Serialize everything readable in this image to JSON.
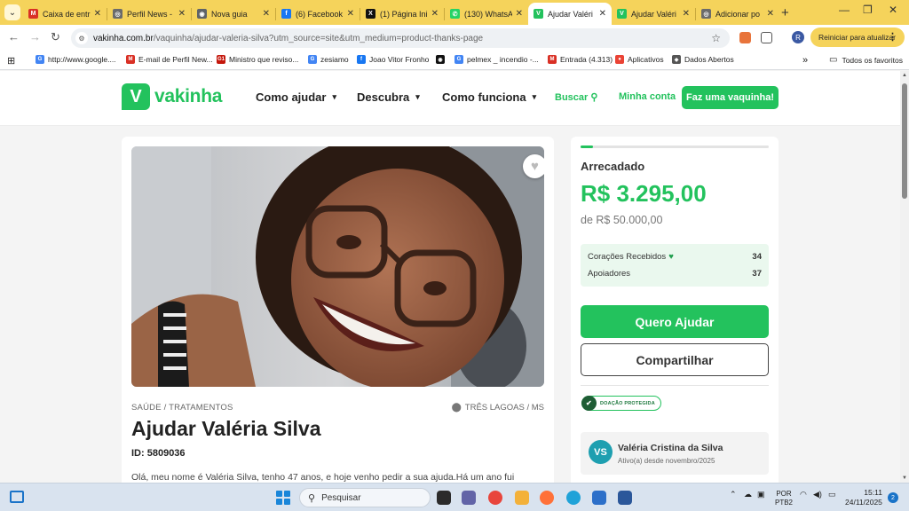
{
  "browser": {
    "tabs": [
      {
        "title": "Caixa de entr",
        "favicon": "gmail-icon",
        "color": "#d93025",
        "glyph": "M",
        "active": false
      },
      {
        "title": "Perfil News -",
        "favicon": "globe-icon",
        "color": "#6b6b6b",
        "glyph": "◎",
        "active": false
      },
      {
        "title": "Nova guia",
        "favicon": "chrome-icon",
        "color": "#5f6368",
        "glyph": "◉",
        "active": false
      },
      {
        "title": "(6) Facebook",
        "favicon": "facebook-icon",
        "color": "#1877f2",
        "glyph": "f",
        "active": false
      },
      {
        "title": "(1) Página Ini",
        "favicon": "x-icon",
        "color": "#111111",
        "glyph": "X",
        "active": false
      },
      {
        "title": "(130) WhatsA",
        "favicon": "whatsapp-icon",
        "color": "#25d366",
        "glyph": "✆",
        "active": false
      },
      {
        "title": "Ajudar Valéri",
        "favicon": "vakinha-icon",
        "color": "#23c25d",
        "glyph": "V",
        "active": true
      },
      {
        "title": "Ajudar Valéri",
        "favicon": "vakinha-icon",
        "color": "#23c25d",
        "glyph": "V",
        "active": false
      },
      {
        "title": "Adicionar po",
        "favicon": "globe-icon",
        "color": "#6b6b6b",
        "glyph": "◎",
        "active": false
      }
    ],
    "url_domain": "vakinha.com.br",
    "url_path": "/vaquinha/ajudar-valeria-silva?utm_source=site&utm_medium=product-thanks-page",
    "profile_initial": "R",
    "update_label": "Reiniciar para atualizar",
    "bookmarks": [
      {
        "label": "http://www.google....",
        "icon": "google-icon",
        "color": "#4285f4",
        "glyph": "G"
      },
      {
        "label": "E-mail de Perfil New...",
        "icon": "gmail-icon",
        "color": "#d93025",
        "glyph": "M"
      },
      {
        "label": "Ministro que reviso...",
        "icon": "g1-icon",
        "color": "#c4170c",
        "glyph": "G1"
      },
      {
        "label": "zesiamo",
        "icon": "google-icon",
        "color": "#4285f4",
        "glyph": "G"
      },
      {
        "label": "Joao Vitor Fronho",
        "icon": "facebook-icon",
        "color": "#1877f2",
        "glyph": "f"
      },
      {
        "label": "",
        "icon": "github-icon",
        "color": "#111111",
        "glyph": "◉"
      },
      {
        "label": "pelmex _ incendio -...",
        "icon": "google-icon",
        "color": "#4285f4",
        "glyph": "G"
      },
      {
        "label": "Entrada (4.313)",
        "icon": "gmail-icon",
        "color": "#d93025",
        "glyph": "M"
      },
      {
        "label": "Aplicativos",
        "icon": "apps-icon",
        "color": "#ea4335",
        "glyph": "●"
      },
      {
        "label": "Dados Abertos",
        "icon": "data-icon",
        "color": "#555555",
        "glyph": "◆"
      }
    ],
    "all_bookmarks_label": "Todos os favoritos"
  },
  "site": {
    "logo_text": "vakinha",
    "nav": [
      "Como ajudar",
      "Descubra",
      "Como funciona"
    ],
    "search_label": "Buscar",
    "account_label": "Minha conta",
    "cta_label": "Faz uma vaquinha!"
  },
  "campaign": {
    "category": "SAÚDE / TRATAMENTOS",
    "location": "TRÊS LAGOAS / MS",
    "title": "Ajudar Valéria Silva",
    "id_label": "ID: 5809036",
    "description": "Olá, meu nome é Valéria Silva, tenho 47 anos, e hoje venho pedir a sua ajuda.Há um ano fui"
  },
  "donation": {
    "progress_fraction": 0.066,
    "raised_label": "Arrecadado",
    "raised_value": "R$ 3.295,00",
    "goal": "de R$ 50.000,00",
    "hearts_label": "Corações Recebidos",
    "hearts_value": "34",
    "supporters_label": "Apoiadores",
    "supporters_value": "37",
    "help_button": "Quero Ajudar",
    "share_button": "Compartilhar",
    "protected_badge": "DOAÇÃO PROTEGIDA"
  },
  "organizer": {
    "initials": "VS",
    "name": "Valéria Cristina da Silva",
    "since": "Ativo(a) desde novembro/2025"
  },
  "taskbar": {
    "search_label": "Pesquisar",
    "language": "POR",
    "layout": "PTB2",
    "time": "15:11",
    "date": "24/11/2025",
    "notifications": "2"
  }
}
